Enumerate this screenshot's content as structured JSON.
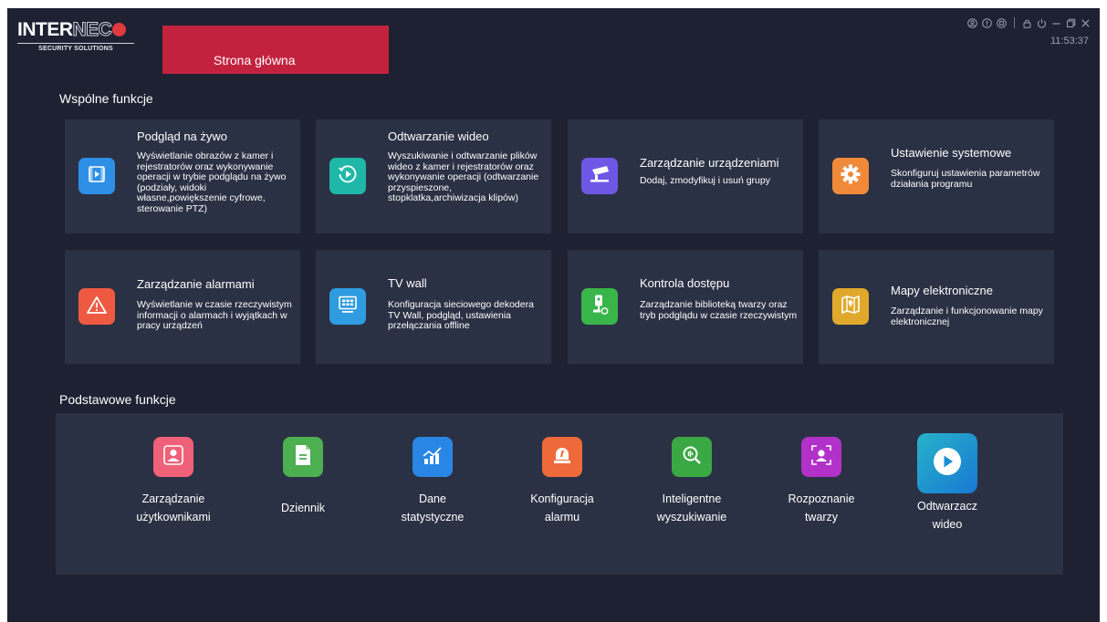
{
  "app": {
    "logo_main_1": "INTER",
    "logo_main_2": "NEC",
    "logo_sub": "SECURITY SOLUTIONS",
    "home_tab": "Strona główna",
    "clock": "11:53:37"
  },
  "colors": {
    "background": "#1d2131",
    "card": "#2b3144",
    "home_tab": "#c3223f"
  },
  "window_controls": [
    "user-icon",
    "info-icon",
    "settings-icon",
    "lock-icon",
    "power-icon",
    "minimize-icon",
    "restore-icon",
    "close-icon"
  ],
  "common": {
    "title": "Wspólne funkcje",
    "cards": [
      {
        "title": "Podgląd na żywo",
        "desc": "Wyświetlanie obrazów  z kamer i rejestratorów oraz wykonywanie operacji w trybie podglądu na żywo (podziały, widoki własne,powiększenie cyfrowe, sterowanie PTZ)",
        "icon": "live-view-icon",
        "color": "#2e8fe6"
      },
      {
        "title": "Odtwarzanie wideo",
        "desc": "Wyszukiwanie i odtwarzanie plików wideo z kamer i rejestratorów oraz wykonywanie operacji (odtwarzanie przyspieszone, stopklatka,archiwizacja klipów)",
        "icon": "playback-icon",
        "color": "#1fb8a8"
      },
      {
        "title": "Zarządzanie urządzeniami",
        "desc": "Dodaj, zmodyfikuj i usuń grupy",
        "icon": "camera-device-icon",
        "color": "#6f57e6"
      },
      {
        "title": "Ustawienie systemowe",
        "desc": "Skonfiguruj ustawienia parametrów działania programu",
        "icon": "gear-icon",
        "color": "#f08a3a"
      },
      {
        "title": "Zarządzanie alarmami",
        "desc": "Wyświetlanie w czasie rzeczywistym informacji o alarmach i wyjątkach w pracy urządzeń",
        "icon": "warning-icon",
        "color": "#ee5a41"
      },
      {
        "title": "TV wall",
        "desc": "Konfiguracja sieciowego dekodera TV Wall, podgląd, ustawienia przełączania offline",
        "icon": "tv-wall-icon",
        "color": "#2f9be0"
      },
      {
        "title": "Kontrola dostępu",
        "desc": "Zarządzanie biblioteką twarzy oraz tryb podglądu w czasie rzeczywistym",
        "icon": "access-control-icon",
        "color": "#39b54a"
      },
      {
        "title": "Mapy elektroniczne",
        "desc": "Zarządzanie i funkcjonowanie mapy elektronicznej",
        "icon": "map-icon",
        "color": "#e0a92b"
      }
    ]
  },
  "basic": {
    "title": "Podstawowe funkcje",
    "items": [
      {
        "label": "Zarządzanie\nużytkownikami",
        "icon": "user-management-icon",
        "color": "#ee6178"
      },
      {
        "label": "Dziennik",
        "icon": "log-icon",
        "color": "#4caf50"
      },
      {
        "label": "Dane\nstatystyczne",
        "icon": "statistics-icon",
        "color": "#2a86e4"
      },
      {
        "label": "Konfiguracja\nalarmu",
        "icon": "alarm-config-icon",
        "color": "#ee6a3b"
      },
      {
        "label": "Inteligentne\nwyszukiwanie",
        "icon": "smart-search-icon",
        "color": "#3aa843"
      },
      {
        "label": "Rozpoznanie\ntwarzy",
        "icon": "face-recognition-icon",
        "color": "#b232c9"
      },
      {
        "label": "Odtwarzacz\nwideo",
        "icon": "video-player-icon",
        "color": "#1b8fd6"
      }
    ]
  }
}
